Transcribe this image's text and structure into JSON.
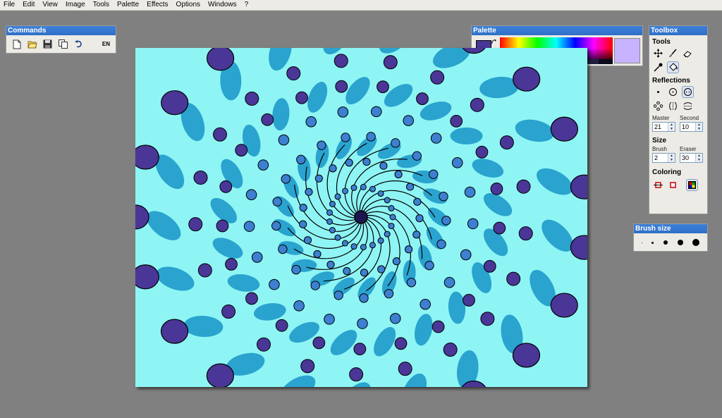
{
  "menu": [
    "File",
    "Edit",
    "View",
    "Image",
    "Tools",
    "Palette",
    "Effects",
    "Options",
    "Windows",
    "?"
  ],
  "commands": {
    "title": "Commands",
    "lang": "EN",
    "buttons": [
      "new-icon",
      "open-icon",
      "save-icon",
      "copy-icon",
      "undo-icon"
    ]
  },
  "palette": {
    "title": "Palette",
    "primary_color": "#4a3696",
    "secondary_color": "#ffffff",
    "selected_swatch_color": "#c7b3ff",
    "gray_swatches": [
      "#cfd4df",
      "#b3b8d6",
      "#8e8fbe",
      "#66689f",
      "#4a4c84",
      "#33345e",
      "#1f2040",
      "#0b0b1a"
    ]
  },
  "toolbox": {
    "title": "Toolbox",
    "tools_label": "Tools",
    "reflections_label": "Reflections",
    "master_label": "Master",
    "second_label": "Second",
    "master_value": "21",
    "second_value": "10",
    "size_label": "Size",
    "brush_label": "Brush",
    "eraser_label": "Eraser",
    "brush_value": "2",
    "eraser_value": "30",
    "coloring_label": "Coloring"
  },
  "brush_size": {
    "title": "Brush size"
  },
  "canvas": {
    "background": "#8ef5f4",
    "band_color": "#2aa3cf",
    "blob_color": "#4a3696",
    "dot_color": "#3d7fd0",
    "center_color": "#1c1650"
  }
}
